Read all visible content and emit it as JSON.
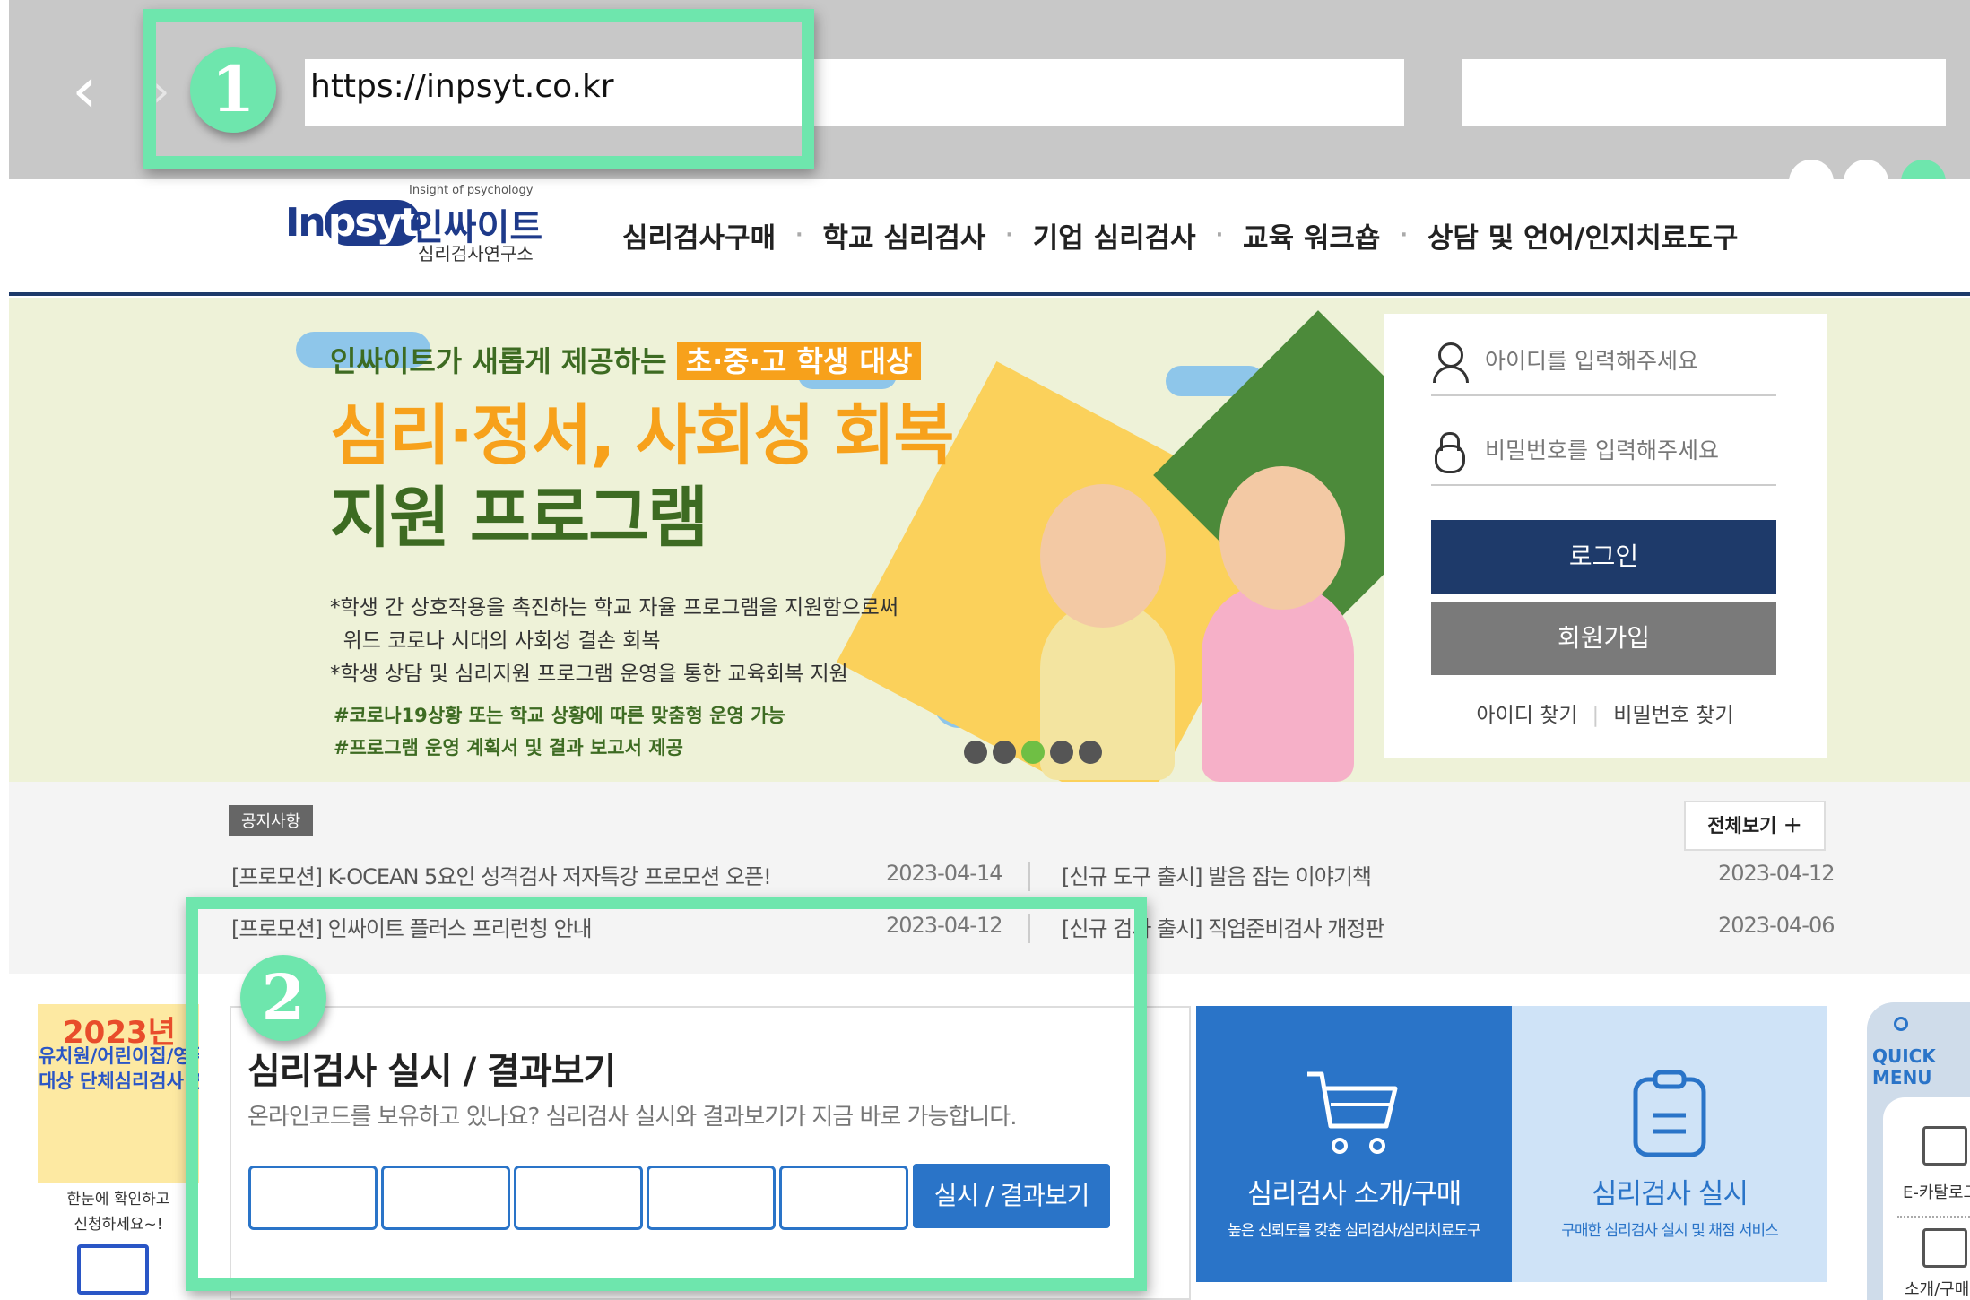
{
  "browser": {
    "url": "https://inpsyt.co.kr",
    "back_glyph": "‹",
    "forward_glyph": "›"
  },
  "annotations": {
    "marker1": "1",
    "marker2": "2",
    "color": "#6ee6ad"
  },
  "logo": {
    "small_text": "Insight of psychology",
    "brand_latin_a": "In",
    "brand_latin_b": "psyt",
    "brand_korean": "인싸이트",
    "sub": "심리검사연구소"
  },
  "nav": {
    "items": [
      "심리검사구매",
      "학교 심리검사",
      "기업 심리검사",
      "교육 워크숍",
      "상담 및 언어/인지치료도구"
    ],
    "separator": "·"
  },
  "banner": {
    "line1_prefix": "인싸이트가 새롭게 제공하는",
    "line1_highlight": "초·중·고 학생 대상",
    "title_line1": "심리·정서, 사회성 회복",
    "title_line2": "지원 프로그램",
    "bullet1": "*학생 간 상호작용을 촉진하는 학교 자율 프로그램을 지원함으로써",
    "bullet1_cont": "  위드 코로나 시대의 사회성 결손 회복",
    "bullet2": "*학생 상담 및 심리지원 프로그램 운영을 통한 교육회복 지원",
    "tag1": "#코로나19상황 또는 학교 상황에 따른 맞춤형 운영 가능",
    "tag2": "#프로그램 운영 계획서 및 결과 보고서 제공",
    "slide_count": 5,
    "active_slide": 3,
    "colors": {
      "accent_orange": "#f7a11b",
      "accent_green": "#3d6b22",
      "background": "#eef2d8"
    }
  },
  "login": {
    "id_placeholder": "아이디를 입력해주세요",
    "pw_placeholder": "비밀번호를 입력해주세요",
    "login_label": "로그인",
    "join_label": "회원가입",
    "find_id": "아이디 찾기",
    "find_pw": "비밀번호 찾기",
    "divider": "|",
    "colors": {
      "login_btn": "#1e3a6a",
      "join_btn": "#7a7a7a"
    }
  },
  "notice": {
    "tag": "공지사항",
    "view_all": "전체보기 ＋",
    "items": [
      {
        "title": "[프로모션] K-OCEAN 5요인 성격검사 저자특강 프로모션 오픈!",
        "date": "2023-04-14"
      },
      {
        "title": "[신규 도구 출시] 발음 잡는 이야기책",
        "date": "2023-04-12"
      },
      {
        "title": "[프로모션] 인싸이트 플러스 프리런칭 안내",
        "date": "2023-04-12"
      },
      {
        "title": "[신규 검사 출시] 직업준비검사 개정판",
        "date": "2023-04-06"
      }
    ]
  },
  "promo": {
    "year": "2023년",
    "title": "유치원/어린이집/영유아 대상 단체심리검사 안내",
    "sub1": "한눈에 확인하고",
    "sub2": "신청하세요~!"
  },
  "exam": {
    "title": "심리검사 실시 / 결과보기",
    "desc": "온라인코드를 보유하고 있나요? 심리검사 실시와 결과보기가 지금 바로 가능합니다.",
    "code_fields": [
      "",
      "",
      "",
      "",
      ""
    ],
    "button": "실시 / 결과보기",
    "accent": "#2a74c8"
  },
  "cards": {
    "buy_title": "심리검사 소개/구매",
    "buy_sub": "높은 신뢰도를 갖춘 심리검사/심리치료도구",
    "run_title": "심리검사 실시",
    "run_sub": "구매한 심리검사 실시 및 채점 서비스",
    "icons": [
      "cart-icon",
      "clipboard-icon"
    ]
  },
  "quick": {
    "label_line1": "QUICK",
    "label_line2": "MENU",
    "item1": "E-카탈로그",
    "item2": "소개/구매"
  }
}
